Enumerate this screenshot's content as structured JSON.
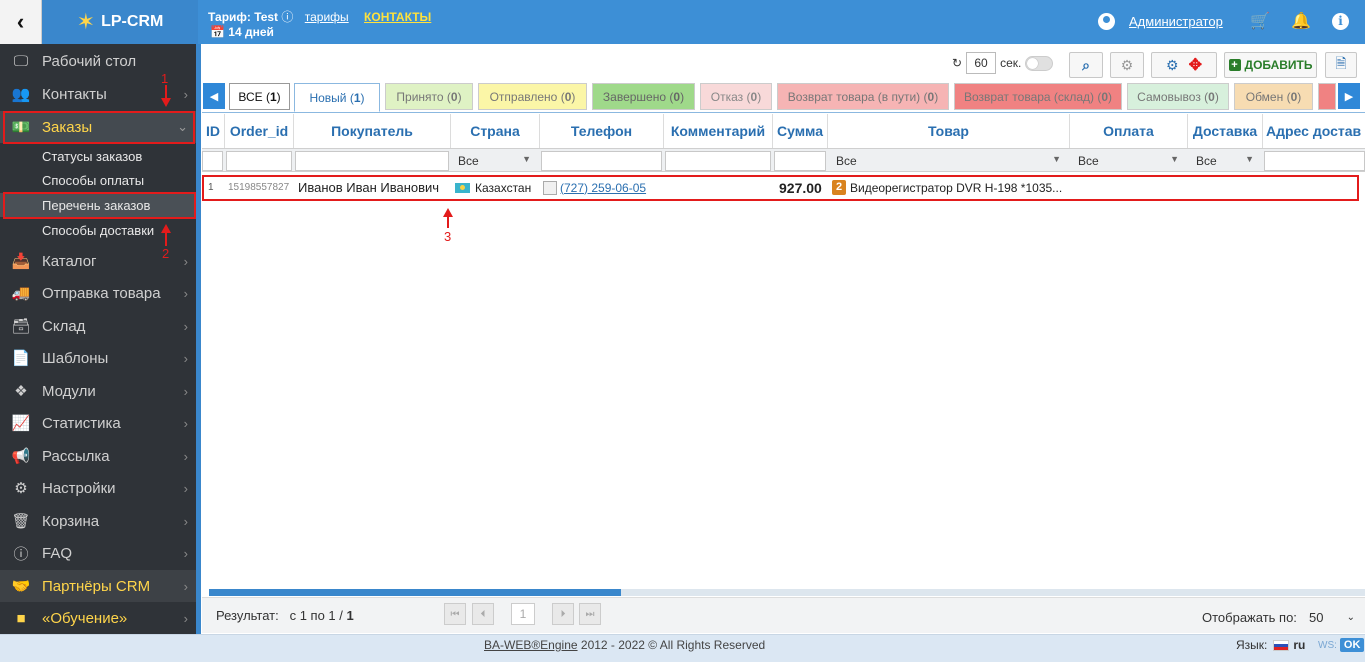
{
  "app": {
    "brand": "LP-CRM",
    "back_icon": "chevron-left-icon"
  },
  "header": {
    "tariff_label": "Тариф:",
    "tariff_name": "Test",
    "tariffs_link": "тарифы",
    "contacts_link": "КОНТАКТЫ",
    "days_left": "14 дней",
    "admin_name": "Администратор"
  },
  "sidebar": {
    "items": [
      {
        "label": "Рабочий стол",
        "icon": "monitor-icon"
      },
      {
        "label": "Контакты",
        "icon": "users-icon"
      },
      {
        "label": "Заказы",
        "icon": "money-icon"
      },
      {
        "label": "Каталог",
        "icon": "inbox-icon"
      },
      {
        "label": "Отправка товара",
        "icon": "truck-icon"
      },
      {
        "label": "Склад",
        "icon": "archive-icon"
      },
      {
        "label": "Шаблоны",
        "icon": "file-icon"
      },
      {
        "label": "Модули",
        "icon": "puzzle-icon"
      },
      {
        "label": "Статистика",
        "icon": "chart-icon"
      },
      {
        "label": "Рассылка",
        "icon": "megaphone-icon"
      },
      {
        "label": "Настройки",
        "icon": "gear-icon"
      },
      {
        "label": "Корзина",
        "icon": "trash-icon"
      },
      {
        "label": "FAQ",
        "icon": "info-icon"
      },
      {
        "label": "Партнёры CRM",
        "icon": "handshake-icon"
      },
      {
        "label": "«Обучение»",
        "icon": "video-icon"
      }
    ],
    "orders_sub": [
      {
        "label": "Статусы заказов"
      },
      {
        "label": "Способы оплаты"
      },
      {
        "label": "Перечень заказов"
      },
      {
        "label": "Способы доставки"
      }
    ]
  },
  "annotations": {
    "one": "1",
    "two": "2",
    "three": "3"
  },
  "toolbar": {
    "refresh_seconds": "60",
    "sec_label": "сек.",
    "add_label": "ДОБАВИТЬ"
  },
  "tabs": [
    {
      "label": "ВСЕ",
      "count": "1",
      "bg": "#ffffff",
      "color": "#111111"
    },
    {
      "label": "Новый",
      "count": "1",
      "bg": "#ffffff",
      "color": "#2a6fb0"
    },
    {
      "label": "Принято",
      "count": "0",
      "bg": "#dff2c4",
      "color": "#777777"
    },
    {
      "label": "Отправлено",
      "count": "0",
      "bg": "#fbf6a7",
      "color": "#777777"
    },
    {
      "label": "Завершено",
      "count": "0",
      "bg": "#9fd98a",
      "color": "#666666"
    },
    {
      "label": "Отказ",
      "count": "0",
      "bg": "#f8d9d9",
      "color": "#888888"
    },
    {
      "label": "Возврат товара (в пути)",
      "count": "0",
      "bg": "#f6b4b4",
      "color": "#777777"
    },
    {
      "label": "Возврат товара (склад)",
      "count": "0",
      "bg": "#f08282",
      "color": "#777777"
    },
    {
      "label": "Самовывоз",
      "count": "0",
      "bg": "#d7f0dc",
      "color": "#777777"
    },
    {
      "label": "Обмен",
      "count": "0",
      "bg": "#f7dcb2",
      "color": "#777777"
    }
  ],
  "table": {
    "columns": [
      "ID",
      "Order_id",
      "Покупатель",
      "Страна",
      "Телефон",
      "Комментарий",
      "Сумма",
      "Товар",
      "Оплата",
      "Доставка",
      "Адрес достав"
    ],
    "filter_all": "Все",
    "rows": [
      {
        "id": "1",
        "order_id": "15198557827",
        "customer": "Иванов Иван Иванович",
        "country": "Казахстан",
        "phone": "(727) 259-06-05",
        "comment": "",
        "sum": "927.00",
        "qty": "2",
        "product": "Видеорегистратор DVR H-198 *1035...",
        "payment": "",
        "delivery": "",
        "address": ""
      }
    ]
  },
  "pager": {
    "result_label": "Результат:",
    "result_range": "с 1 по 1 /",
    "result_total": "1",
    "page": "1",
    "per_page_label": "Отображать по:",
    "per_page": "50"
  },
  "footer": {
    "engine": "BA-WEB®Engine",
    "copyright": "2012 - 2022 © All Rights Reserved",
    "lang_label": "Язык:",
    "lang": "ru",
    "ws": "WS:",
    "ws_status": "OK"
  },
  "colors": {
    "accent": "#3d8fd6",
    "sidebar": "#2f3338",
    "highlight": "#ffd54a",
    "annotation": "#e31b1b"
  }
}
